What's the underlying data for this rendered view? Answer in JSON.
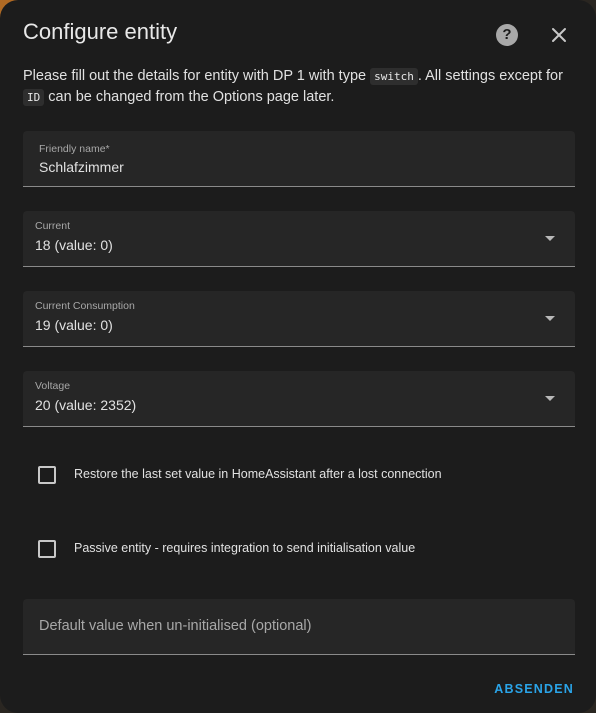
{
  "dialog": {
    "title": "Configure entity",
    "description_before": "Please fill out the details for entity with DP 1 with type",
    "type_code": "switch",
    "description_middle": ". All settings except for",
    "id_code": "ID",
    "description_after": "can be changed from the Options page later."
  },
  "fields": {
    "friendly_name": {
      "label": "Friendly name*",
      "value": "Schlafzimmer"
    },
    "current": {
      "label": "Current",
      "value": "18 (value: 0)"
    },
    "current_consumption": {
      "label": "Current Consumption",
      "value": "19 (value: 0)"
    },
    "voltage": {
      "label": "Voltage",
      "value": "20 (value: 2352)"
    },
    "default_value": {
      "placeholder": "Default value when un-initialised (optional)"
    }
  },
  "checkboxes": {
    "restore": {
      "label": "Restore the last set value in HomeAssistant after a lost connection",
      "checked": false
    },
    "passive": {
      "label": "Passive entity - requires integration to send initialisation value",
      "checked": false
    }
  },
  "actions": {
    "submit_label": "ABSENDEN"
  },
  "icons": {
    "help": "help-circle-icon",
    "close": "close-icon",
    "dropdown": "chevron-down-icon"
  },
  "colors": {
    "accent": "#2aa4e8",
    "dialog_bg": "#1c1c1c",
    "field_bg": "#262626"
  }
}
